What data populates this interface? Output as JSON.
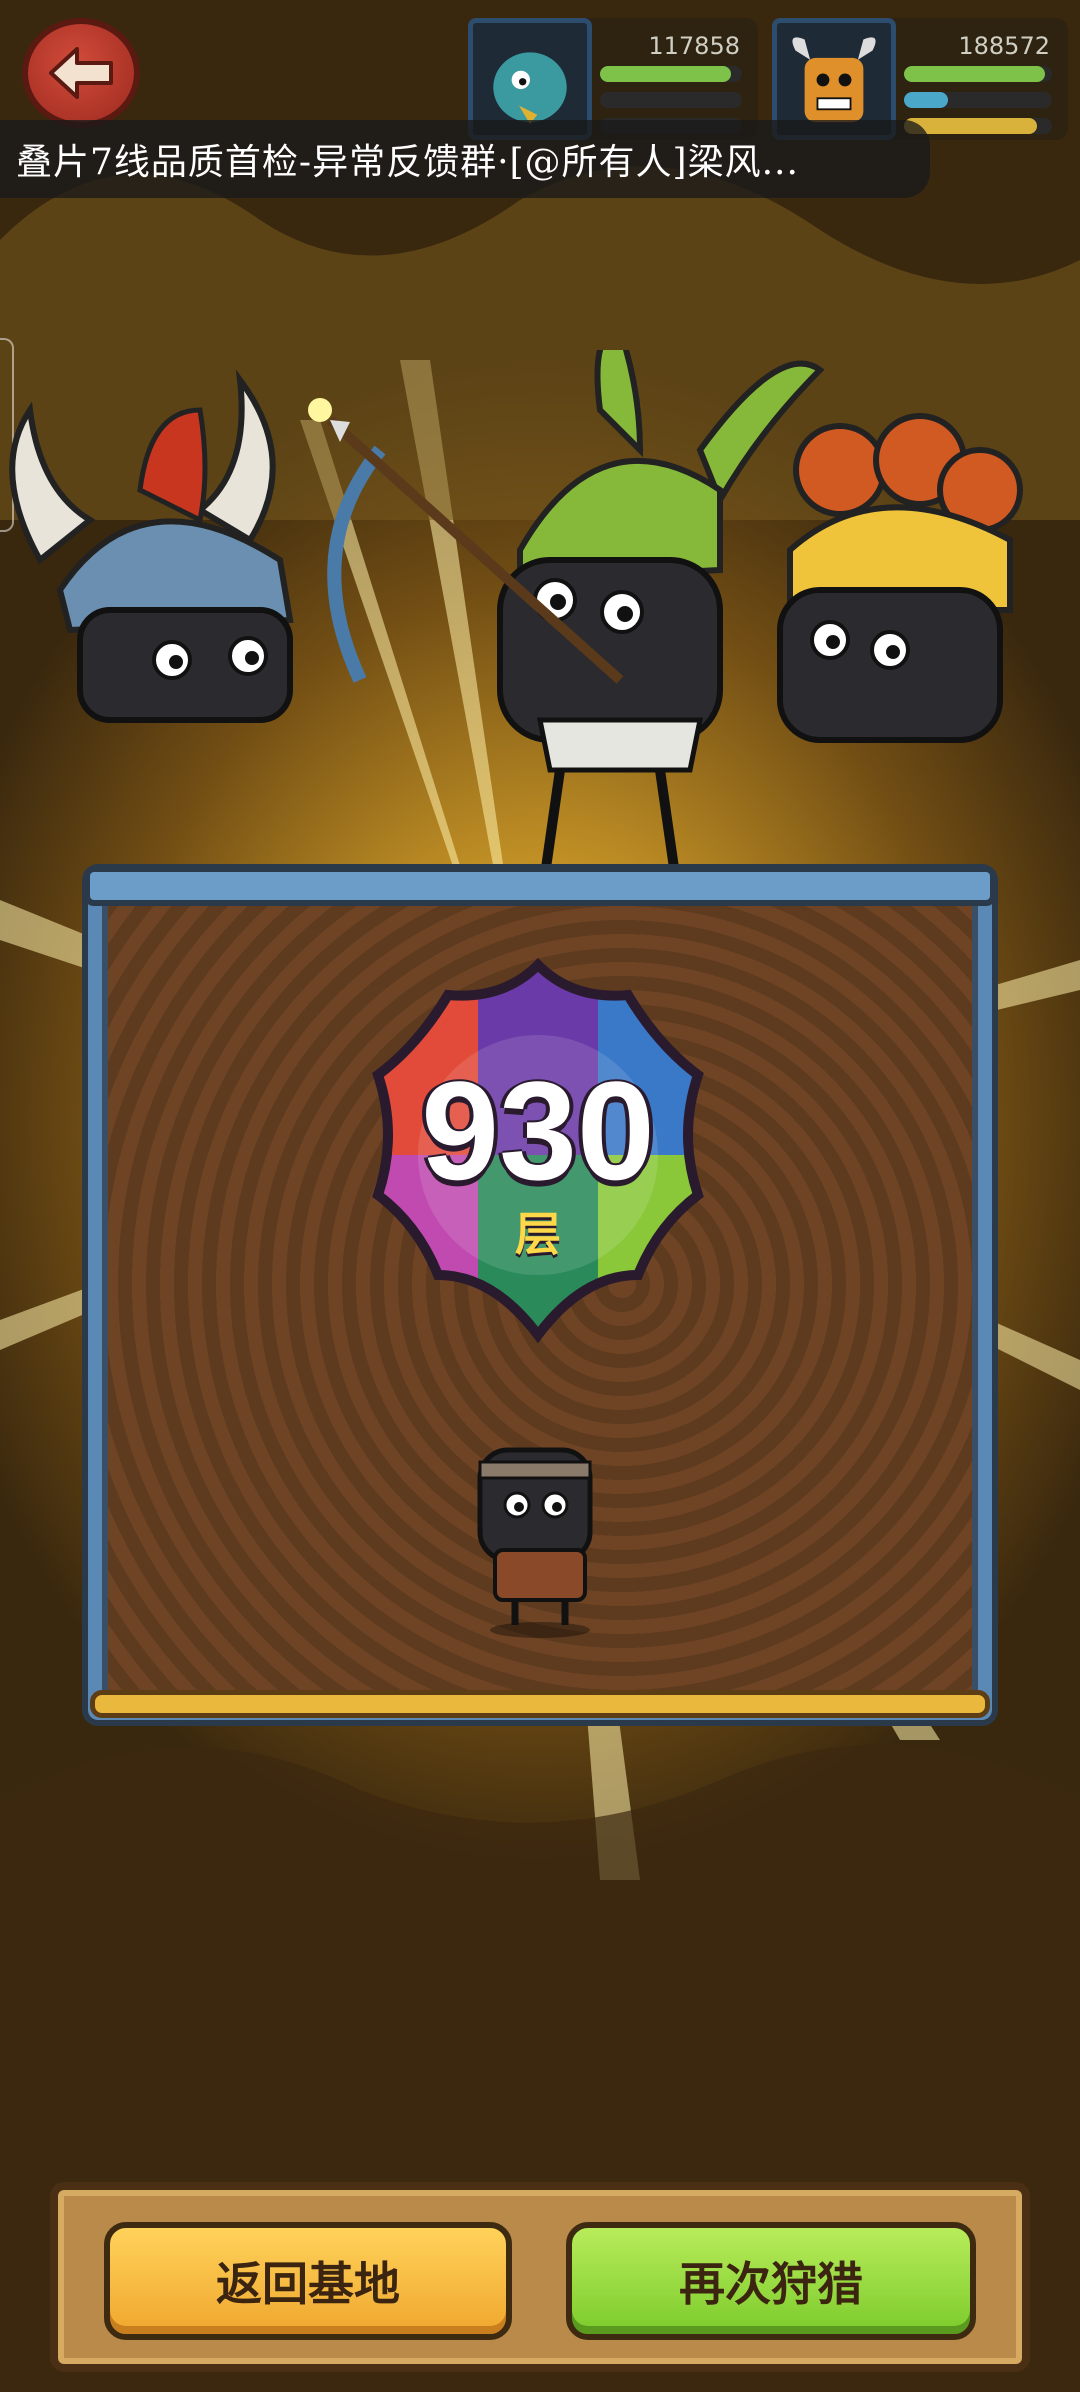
{
  "top_bar": {
    "back_icon": "back-arrow-icon",
    "players": [
      {
        "score": "117858",
        "avatar_icon": "teal-monster-avatar",
        "bars": [
          {
            "color": "#7fc24a",
            "level": 0.92
          },
          {
            "color": "#2a2a2a",
            "level": 0.0
          },
          {
            "color": "#2a2a2a",
            "level": 0.0
          }
        ]
      },
      {
        "score": "188572",
        "avatar_icon": "horned-orange-monster-avatar",
        "bars": [
          {
            "color": "#7fc24a",
            "level": 0.95
          },
          {
            "color": "#4ba7c9",
            "level": 0.3
          },
          {
            "color": "#d8b23a",
            "level": 0.9
          }
        ]
      }
    ]
  },
  "notification": {
    "text": "叠片7线品质首检-异常反馈群·[@所有人]梁风..."
  },
  "result": {
    "floor_number": "930",
    "floor_unit": "层"
  },
  "buttons": {
    "return_base": "返回基地",
    "hunt_again": "再次狩猎"
  },
  "colors": {
    "accent_yellow": "#f0a72e",
    "accent_green": "#7ccb2c",
    "board_border": "#5a89b5"
  }
}
